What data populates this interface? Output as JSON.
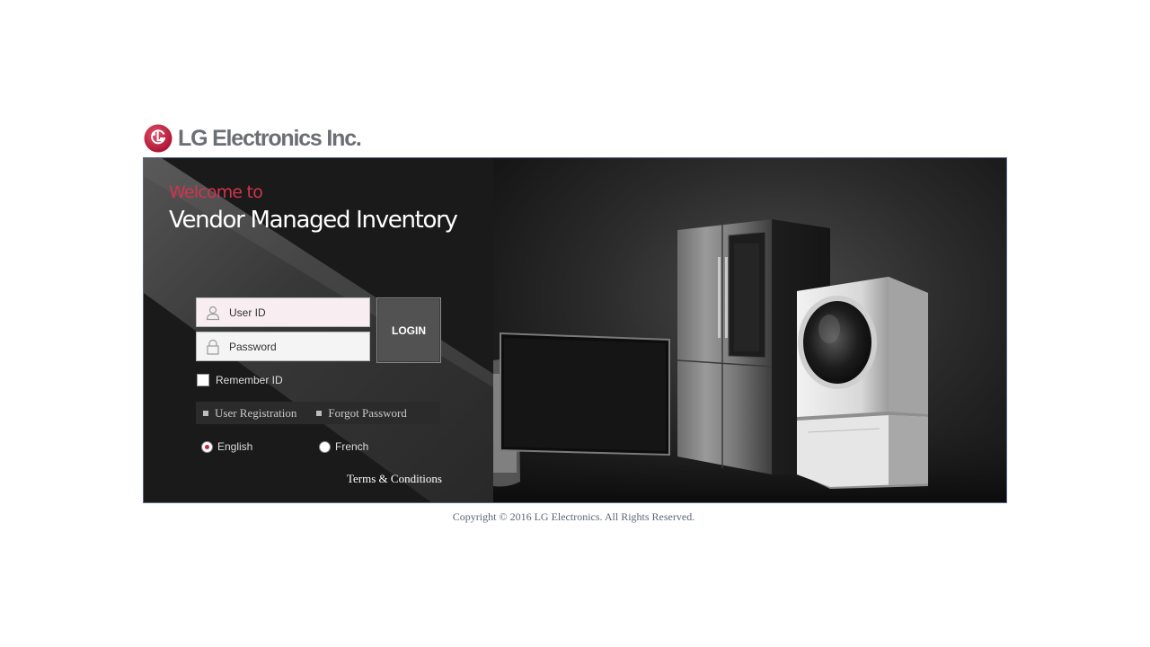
{
  "brand": {
    "logo_text": "LG Electronics Inc.",
    "accent_color": "#c4263e"
  },
  "hero": {
    "welcome": "Welcome to",
    "title": "Vendor Managed Inventory"
  },
  "login": {
    "user_placeholder": "User ID",
    "user_icon": "user-icon",
    "password_placeholder": "Password",
    "password_icon": "lock-icon",
    "button_label": "LOGIN",
    "remember_label": "Remember ID",
    "remember_checked": false
  },
  "links": {
    "registration": "User Registration",
    "forgot": "Forgot Password"
  },
  "language": {
    "options": [
      "English",
      "French"
    ],
    "selected": "English"
  },
  "terms_label": "Terms & Conditions",
  "copyright": "Copyright © 2016 LG Electronics. All Rights Reserved."
}
